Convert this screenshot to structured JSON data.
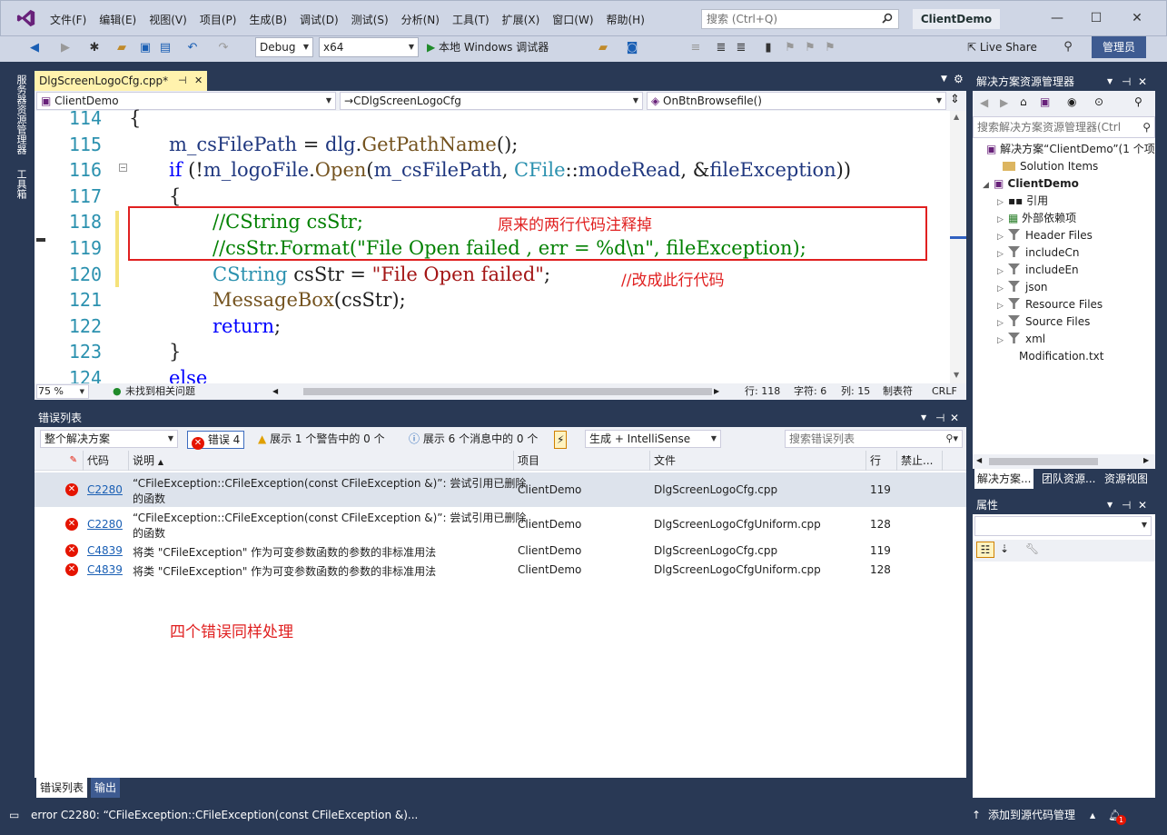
{
  "app": {
    "title": "ClientDemo",
    "menu": [
      "文件(F)",
      "编辑(E)",
      "视图(V)",
      "项目(P)",
      "生成(B)",
      "调试(D)",
      "测试(S)",
      "分析(N)",
      "工具(T)",
      "扩展(X)",
      "窗口(W)",
      "帮助(H)"
    ],
    "search_placeholder": "搜索 (Ctrl+Q)",
    "live_share": "Live Share",
    "admin": "管理员"
  },
  "toolbar": {
    "config": "Debug",
    "platform": "x64",
    "debugger": "本地 Windows 调试器"
  },
  "left_strip": {
    "server_explorer": "服务器资源管理器",
    "toolbox": "工具箱"
  },
  "editor": {
    "tab_title": "DlgScreenLogoCfg.cpp*",
    "nav_project": "ClientDemo",
    "nav_class": "CDlgScreenLogoCfg",
    "nav_method": "OnBtnBrowsefile()",
    "line_numbers": [
      "114",
      "115",
      "116",
      "117",
      "118",
      "119",
      "120",
      "121",
      "122",
      "123",
      "124"
    ],
    "code": {
      "l114": "{",
      "l115_a": "m_csFilePath",
      "l115_b": " = ",
      "l115_c": "dlg",
      "l115_d": ".",
      "l115_e": "GetPathName",
      "l115_f": "();",
      "l116_a": "if",
      "l116_b": " (!",
      "l116_c": "m_logoFile",
      "l116_d": ".",
      "l116_e": "Open",
      "l116_f": "(",
      "l116_g": "m_csFilePath",
      "l116_h": ", ",
      "l116_i": "CFile",
      "l116_j": "::",
      "l116_k": "modeRead",
      "l116_l": ", &",
      "l116_m": "fileException",
      "l116_n": "))",
      "l117": "{",
      "l118": "//CString csStr;",
      "l119": "//csStr.Format(\"File Open failed , err = %d\\n\", fileException);",
      "l120_a": "CString",
      "l120_b": " csStr = ",
      "l120_c": "\"File Open failed\"",
      "l120_d": ";",
      "l121_a": "MessageBox",
      "l121_b": "(csStr);",
      "l122_a": "return",
      "l122_b": ";",
      "l123": "}",
      "l124": "else"
    },
    "annotation_1": "原来的两行代码注释掉",
    "annotation_2": "//改成此行代码",
    "zoom": "75 %",
    "issues": "未找到相关问题",
    "pos_line": "行: 118",
    "pos_char": "字符: 6",
    "pos_col": "列: 15",
    "tab_mode": "制表符",
    "eol": "CRLF"
  },
  "error_list": {
    "title": "错误列表",
    "scope": "整个解决方案",
    "errors_btn": "错误 4",
    "warnings_btn": "展示 1 个警告中的 0 个",
    "messages_btn": "展示 6 个消息中的 0 个",
    "build_filter": "生成 + IntelliSense",
    "search_placeholder": "搜索错误列表",
    "headers": {
      "code": "代码",
      "desc": "说明",
      "project": "项目",
      "file": "文件",
      "line": "行",
      "suppress": "禁止..."
    },
    "rows": [
      {
        "code": "C2280",
        "desc1": "“CFileException::CFileException(const CFileException &)”: 尝试引用已删除",
        "desc2": "的函数",
        "project": "ClientDemo",
        "file": "DlgScreenLogoCfg.cpp",
        "line": "119"
      },
      {
        "code": "C2280",
        "desc1": "“CFileException::CFileException(const CFileException &)”: 尝试引用已删除",
        "desc2": "的函数",
        "project": "ClientDemo",
        "file": "DlgScreenLogoCfgUniform.cpp",
        "line": "128"
      },
      {
        "code": "C4839",
        "desc1": "将类 \"CFileException\" 作为可变参数函数的参数的非标准用法",
        "desc2": "",
        "project": "ClientDemo",
        "file": "DlgScreenLogoCfg.cpp",
        "line": "119"
      },
      {
        "code": "C4839",
        "desc1": "将类 \"CFileException\" 作为可变参数函数的参数的非标准用法",
        "desc2": "",
        "project": "ClientDemo",
        "file": "DlgScreenLogoCfgUniform.cpp",
        "line": "128"
      }
    ],
    "annotation": "四个错误同样处理",
    "tab_errors": "错误列表",
    "tab_output": "输出"
  },
  "solution_explorer": {
    "title": "解决方案资源管理器",
    "search_placeholder": "搜索解决方案资源管理器(Ctrl",
    "solution": "解决方案“ClientDemo”(1 个项",
    "items": [
      {
        "label": "Solution Items",
        "kind": "folder"
      },
      {
        "label": "ClientDemo",
        "kind": "project"
      },
      {
        "label": "引用",
        "kind": "ref"
      },
      {
        "label": "外部依赖项",
        "kind": "ext"
      },
      {
        "label": "Header Files",
        "kind": "filter"
      },
      {
        "label": "includeCn",
        "kind": "filter"
      },
      {
        "label": "includeEn",
        "kind": "filter"
      },
      {
        "label": "json",
        "kind": "filter"
      },
      {
        "label": "Resource Files",
        "kind": "filter"
      },
      {
        "label": "Source Files",
        "kind": "filter"
      },
      {
        "label": "xml",
        "kind": "filter"
      },
      {
        "label": "Modification.txt",
        "kind": "file"
      }
    ],
    "tabs": [
      "解决方案...",
      "团队资源...",
      "资源视图"
    ]
  },
  "properties": {
    "title": "属性"
  },
  "status": {
    "message": "error C2280: “CFileException::CFileException(const CFileException &)...",
    "source_control": "添加到源代码管理",
    "notif_count": "1"
  },
  "colors": {
    "chrome_dark": "#293955",
    "chrome_light": "#cfd6e5",
    "annotation": "#e02020",
    "error": "#e51400",
    "admin": "#3e5b91"
  }
}
